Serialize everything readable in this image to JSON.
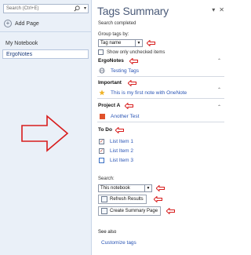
{
  "sidebar": {
    "search_placeholder": "Search (Ctrl+E)",
    "add_page_label": "Add Page",
    "notebook_name": "My Notebook",
    "page_name": "ErgoNotes"
  },
  "panel": {
    "title": "Tags Summary",
    "status": "Search completed",
    "group_by_label": "Group tags by:",
    "group_by_value": "Tag name",
    "show_unchecked_label": "Show only unchecked items",
    "sections": [
      {
        "heading": "ErgoNotes",
        "items": [
          {
            "label": "Testing Tags",
            "icon": "globe-icon"
          }
        ]
      },
      {
        "heading": "Important",
        "items": [
          {
            "label": "This is my first note with OneNote",
            "icon": "star-icon"
          }
        ]
      },
      {
        "heading": "Project A",
        "items": [
          {
            "label": "Another Test",
            "icon": "project-a-icon"
          }
        ]
      },
      {
        "heading": "To Do",
        "items": [
          {
            "label": "List Item 1",
            "checked": true
          },
          {
            "label": "List Item 2",
            "checked": true
          },
          {
            "label": "List Item 3",
            "checked": false
          }
        ]
      }
    ],
    "search_label": "Search:",
    "search_scope": "This notebook",
    "refresh_label": "Refresh Results",
    "create_summary_label": "Create Summary Page",
    "see_also": "See also",
    "customize_link": "Customize tags"
  },
  "colors": {
    "annotation_red": "#d81c1c",
    "link_blue": "#2a55b5",
    "star_yellow": "#f0b429",
    "project_orange": "#e0522b"
  }
}
